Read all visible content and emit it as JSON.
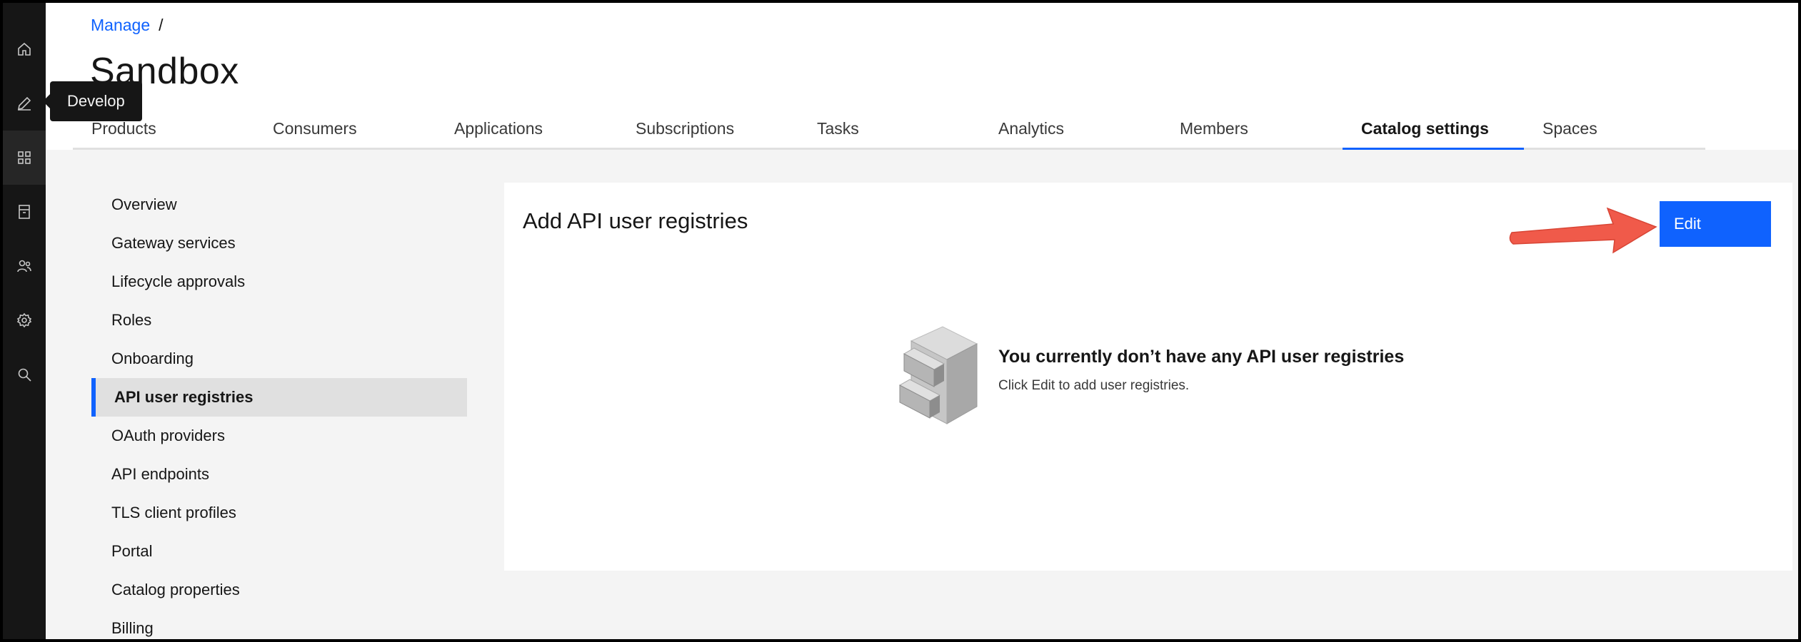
{
  "rail": {
    "items": [
      {
        "icon": "home-icon",
        "label": "Home"
      },
      {
        "icon": "edit-icon",
        "label": "Develop"
      },
      {
        "icon": "apps-icon",
        "label": "Manage"
      },
      {
        "icon": "archive-icon",
        "label": "Archive"
      },
      {
        "icon": "users-icon",
        "label": "Members"
      },
      {
        "icon": "settings-icon",
        "label": "Settings"
      },
      {
        "icon": "search-icon",
        "label": "Search"
      }
    ],
    "tooltip": "Develop"
  },
  "breadcrumb": {
    "link": "Manage",
    "separator": "/"
  },
  "page_title": "Sandbox",
  "tabs": [
    {
      "label": "Products"
    },
    {
      "label": "Consumers"
    },
    {
      "label": "Applications"
    },
    {
      "label": "Subscriptions"
    },
    {
      "label": "Tasks"
    },
    {
      "label": "Analytics"
    },
    {
      "label": "Members"
    },
    {
      "label": "Catalog settings",
      "selected": true
    },
    {
      "label": "Spaces"
    }
  ],
  "sidenav": {
    "items": [
      {
        "label": "Overview"
      },
      {
        "label": "Gateway services"
      },
      {
        "label": "Lifecycle approvals"
      },
      {
        "label": "Roles"
      },
      {
        "label": "Onboarding"
      },
      {
        "label": "API user registries",
        "active": true
      },
      {
        "label": "OAuth providers"
      },
      {
        "label": "API endpoints"
      },
      {
        "label": "TLS client profiles"
      },
      {
        "label": "Portal"
      },
      {
        "label": "Catalog properties"
      },
      {
        "label": "Billing"
      }
    ]
  },
  "panel": {
    "title": "Add API user registries",
    "edit_label": "Edit",
    "empty_title": "You currently don’t have any API user registries",
    "empty_body": "Click Edit to add user registries."
  },
  "colors": {
    "accent": "#0f62fe",
    "rail_bg": "#161616",
    "content_bg": "#f4f4f4",
    "annotation_arrow": "#f05a4a"
  }
}
